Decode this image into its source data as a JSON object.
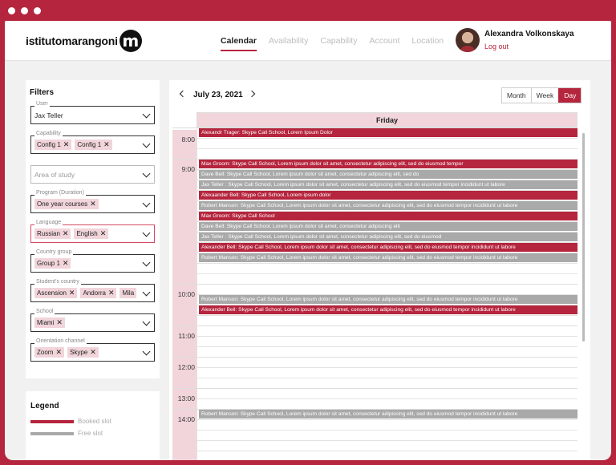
{
  "colors": {
    "accent": "#b5253d",
    "booked": "#b5253d",
    "free": "#a9a9a9",
    "chip": "#f1d5da"
  },
  "brand": {
    "name": "istitutomarangoni",
    "mark": "m"
  },
  "nav": {
    "items": [
      "Calendar",
      "Availability",
      "Capability",
      "Account",
      "Location"
    ],
    "active": "Calendar"
  },
  "user": {
    "name": "Alexandra Volkonskaya",
    "logout": "Log out"
  },
  "filters": {
    "title": "Filters",
    "fields": [
      {
        "label": "User",
        "value": "Jax Teller"
      },
      {
        "label": "Capability",
        "chips": [
          "Config 1",
          "Config 1"
        ]
      },
      {
        "label": "",
        "placeholder": "Area of study"
      },
      {
        "label": "Program (Duration)",
        "chips": [
          "One year courses"
        ]
      },
      {
        "label": "Language",
        "chips": [
          "Russian",
          "English"
        ]
      },
      {
        "label": "Country group",
        "chips": [
          "Group 1"
        ]
      },
      {
        "label": "Student's country",
        "chips": [
          "Ascension",
          "Andorra",
          "Mila"
        ]
      },
      {
        "label": "School",
        "chips": [
          "Miami"
        ]
      },
      {
        "label": "Orientation channel",
        "chips": [
          "Zoom",
          "Skype"
        ]
      }
    ]
  },
  "legend": {
    "title": "Legend",
    "booked": "Booked slot",
    "free": "Free slot"
  },
  "calendar": {
    "date": "July 23, 2021",
    "views": [
      "Month",
      "Week",
      "Day"
    ],
    "active_view": "Day",
    "day": "Friday",
    "times": [
      "8:00",
      "9:00",
      "10:00",
      "11:00",
      "12:00",
      "13:00",
      "14:00"
    ],
    "events": [
      {
        "slot": "8:00",
        "status": "booked",
        "text": "Alexandr Trager: Skype Call School, Lorem Ipsum Dolor"
      },
      {
        "slot": "9:00",
        "status": "booked",
        "text": "Max Groom: Skype Call School, Lorem ipsum dolor sit amet, consectetur adipiscing elit, sed do eiusmod tempor"
      },
      {
        "slot": "9:00",
        "status": "free",
        "text": "Dave Bell: Skype Call School, Lorem ipsum dolor sit amet, consectetur adipiscing elit, sed do"
      },
      {
        "slot": "9:00",
        "status": "free",
        "text": "Jax Teller : Skype Call School, Lorem ipsum dolor sit amet, consectetur adipiscing elit, sed do eiusmod tempor incididunt ut labore"
      },
      {
        "slot": "9:00",
        "status": "booked",
        "text": "Alexaander Bell: Skype Call School, Lorem ipsum dolor"
      },
      {
        "slot": "9:00",
        "status": "free",
        "text": "Robert Manson: Skype Call School, Lorem ipsum dolor sit amet, consectetur adipiscing elit, sed do eiusmod tempor incididunt ut labore"
      },
      {
        "slot": "9:00",
        "status": "booked",
        "text": "Max Groom: Skype Call School"
      },
      {
        "slot": "9:00",
        "status": "free",
        "text": "Dave Bell: Skype Call School, Lorem ipsum dolor sit amet, consectetur adipiscing elit"
      },
      {
        "slot": "9:00",
        "status": "free",
        "text": "Jax Teller : Skype Call School, Lorem ipsum dolor sit amet, consectetur adipiscing elit, sed do eiusmod"
      },
      {
        "slot": "9:00",
        "status": "booked",
        "text": "Alexander Bell: Skype Call School, Lorem ipsum dolor sit amet, consectetur adipiscing elit, sed do eiusmod tempor incididunt ut labore"
      },
      {
        "slot": "9:00",
        "status": "free",
        "text": "Robert Manson: Skype Call School, Lorem ipsum dolor sit amet, consectetur adipiscing elit, sed do eiusmod tempor incididunt ut labore"
      },
      {
        "slot": "10:00",
        "status": "free",
        "text": "Robert Manson: Skype Call School, Lorem ipsum dolor sit amet, consectetur adipiscing elit, sed do eiusmod tempor incididunt ut labore"
      },
      {
        "slot": "10:00",
        "status": "booked",
        "text": "Alexander Bell: Skype Call School, Lorem ipsum dolor sit amet, consectetur adipiscing elit, sed do eiusmod tempor incididunt ut labore"
      },
      {
        "slot": "14:00",
        "status": "free",
        "text": "Robert Manson: Skype Call School, Lorem ipsum dolor sit amet, consectetur adipiscing elit, sed do eiusmod tempor incididunt ut labore"
      }
    ]
  }
}
